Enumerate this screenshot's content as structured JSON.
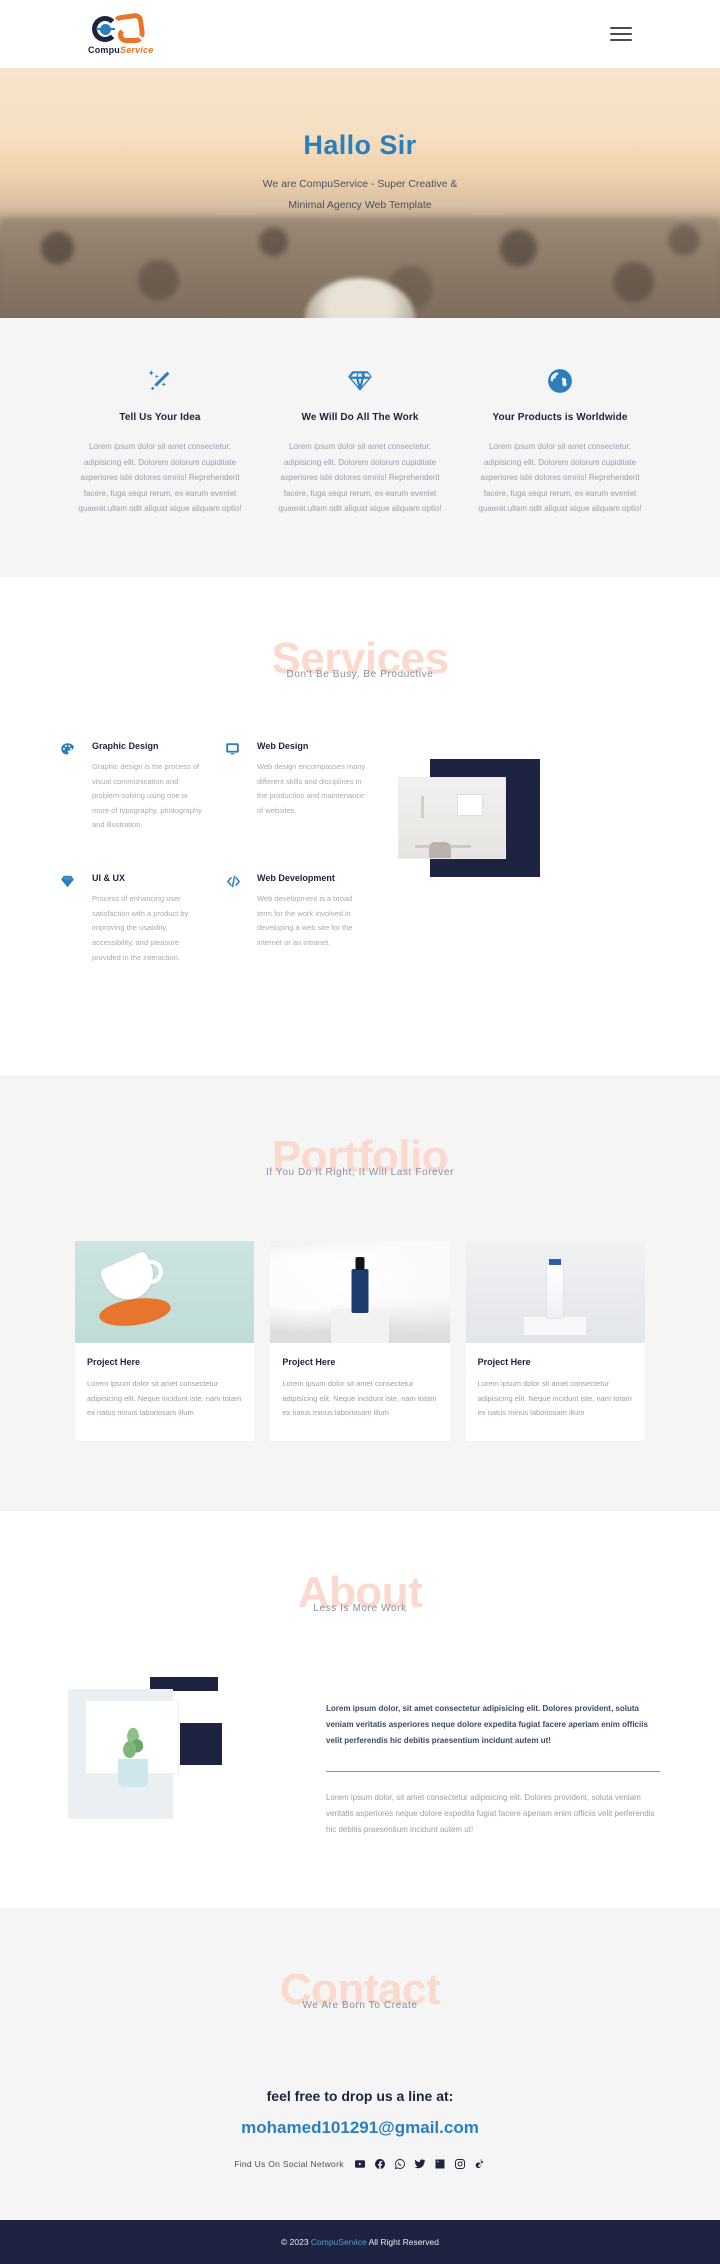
{
  "navbar": {
    "logo_primary": "Compu",
    "logo_secondary": "Service",
    "menu_icon": "hamburger-menu-icon"
  },
  "hero": {
    "title": "Hallo Sir",
    "subtitle": "We are CompuService - Super Creative & Minimal Agency Web Template"
  },
  "features": [
    {
      "icon": "magic-wand-icon",
      "title": "Tell Us Your Idea",
      "text": "Lorem ipsum dolor sit amet consectetur, adipisicing elit. Dolorem dolorum cupiditate asperiores iste dolores omnis! Reprehenderit facere, fuga sequi rerum, ex earum eveniet quaerat ullam odit aliquid atque aliquam optio!"
    },
    {
      "icon": "diamond-icon",
      "title": "We Will Do All The Work",
      "text": "Lorem ipsum dolor sit amet consectetur, adipisicing elit. Dolorem dolorum cupiditate asperiores iste dolores omnis! Reprehenderit facere, fuga sequi rerum, ex earum eveniet quaerat ullam odit aliquid atque aliquam optio!"
    },
    {
      "icon": "globe-icon",
      "title": "Your Products is Worldwide",
      "text": "Lorem ipsum dolor sit amet consectetur, adipisicing elit. Dolorem dolorum cupiditate asperiores iste dolores omnis! Reprehenderit facere, fuga sequi rerum, ex earum eveniet quaerat ullam odit aliquid atque aliquam optio!"
    }
  ],
  "services": {
    "heading": "Services",
    "subheading": "Don't Be Busy, Be Productive",
    "items": [
      {
        "icon": "palette-icon",
        "title": "Graphic Design",
        "text": "Graphic design is the process of visual communication and problem-solving using one or more of typography, photography and illustration."
      },
      {
        "icon": "monitor-icon",
        "title": "Web Design",
        "text": "Web design encompasses many different skills and disciplines in the production and maintenance of websites."
      },
      {
        "icon": "gem-icon",
        "title": "UI & UX",
        "text": "Process of enhancing user satisfaction with a product by improving the usability, accessibility, and pleasure provided in the interaction."
      },
      {
        "icon": "code-icon",
        "title": "Web Development",
        "text": "Web development is a broad term for the work involved in developing a web site for the internet or an intranet."
      }
    ]
  },
  "portfolio": {
    "heading": "Portfolio",
    "subheading": "If You Do It Right, It Will Last Forever",
    "cards": [
      {
        "image": "coffee-cup-mockup",
        "title": "Project Here",
        "text": "Lorem ipsum dolor sit amet consectetur adipisicing elit. Neque incidunt iste, nam totam ex natus minus laboriosam illum"
      },
      {
        "image": "serum-bottle-mockup",
        "title": "Project Here",
        "text": "Lorem ipsum dolor sit amet consectetur adipisicing elit. Neque incidunt iste, nam totam ex natus minus laboriosam illum"
      },
      {
        "image": "tube-mockup",
        "title": "Project Here",
        "text": "Lorem ipsum dolor sit amet consectetur adipisicing elit. Neque incidunt iste, nam totam ex natus minus laboriosam illum"
      }
    ]
  },
  "about": {
    "heading": "About",
    "subheading": "Less Is More Work",
    "image": "potted-plant-photo",
    "lead": "Lorem ipsum dolor, sit amet consectetur adipisicing elit. Dolores provident, soluta veniam veritatis asperiores neque dolore expedita fugiat facere aperiam enim officiis velit perferendis hic debitis praesentium incidunt autem ut!",
    "body": "Lorem ipsum dolor, sit amet consectetur adipisicing elit. Dolores provident, soluta veniam veritatis asperiores neque dolore expedita fugiat facere aperiam enim officiis velit perferendis hic debitis praesentium incidunt autem ut!"
  },
  "contact": {
    "heading": "Contact",
    "subheading": "We Are Born To Create",
    "cta": "feel free to drop us a line at:",
    "email": "mohamed101291@gmail.com",
    "social_label": "Find Us On Social Network",
    "social": [
      "youtube-icon",
      "facebook-icon",
      "whatsapp-icon",
      "twitter-icon",
      "linkedin-icon",
      "instagram-icon",
      "tiktok-icon"
    ]
  },
  "footer": {
    "copyright_prefix": "© 2023 ",
    "brand": "CompuService",
    "copyright_suffix": " All Right Reserved"
  },
  "colors": {
    "accent_blue": "#2a7fc1",
    "navy": "#1d2340",
    "peach": "#fbd9cd",
    "orange": "#e8762a",
    "light_gray": "#f5f5f5"
  }
}
